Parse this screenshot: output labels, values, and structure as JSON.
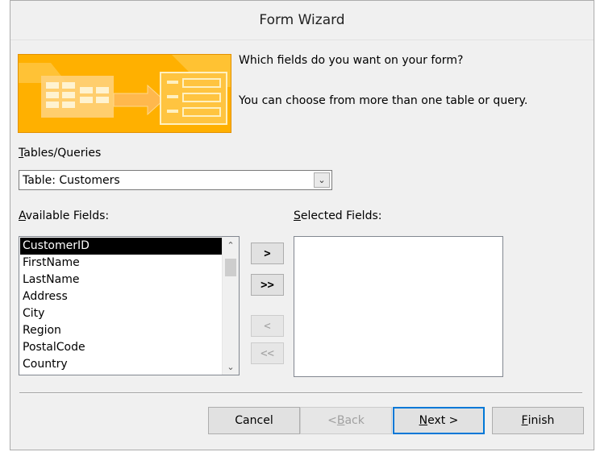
{
  "window": {
    "title": "Form Wizard"
  },
  "intro": {
    "line1": "Which fields do you want on your form?",
    "line2": "You can choose from more than one table or query."
  },
  "tables_label": "Tables/Queries",
  "tables_label_hotkey": "T",
  "tables_label_rest": "ables/Queries",
  "table_combo": {
    "value": "Table: Customers"
  },
  "available_label_hotkey": "A",
  "available_label_rest": "vailable Fields:",
  "available_fields": [
    "CustomerID",
    "FirstName",
    "LastName",
    "Address",
    "City",
    "Region",
    "PostalCode",
    "Country"
  ],
  "selected_field_index": 0,
  "selected_label_hotkey": "S",
  "selected_label_rest": "elected Fields:",
  "selected_fields": [],
  "move_buttons": {
    "add_one": ">",
    "add_all": ">>",
    "remove_one": "<",
    "remove_all": "<<"
  },
  "buttons": {
    "cancel": "Cancel",
    "back_prefix": "< ",
    "back_hotkey": "B",
    "back_rest": "ack",
    "next_hotkey": "N",
    "next_rest": "ext >",
    "finish_hotkey": "F",
    "finish_rest": "inish"
  },
  "colors": {
    "illustration_bg": "#ffb000",
    "default_button_border": "#0078d7",
    "selection_bg": "#000000"
  },
  "icons": {
    "combo_dropdown": "chevron-down-icon",
    "scroll_up": "chevron-up-icon",
    "scroll_down": "chevron-down-icon"
  }
}
